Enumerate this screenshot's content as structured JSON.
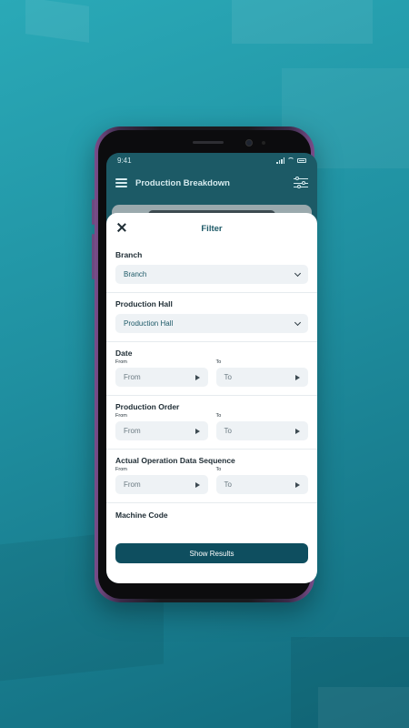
{
  "status_bar": {
    "time": "9:41"
  },
  "app_bar": {
    "title": "Production Breakdown"
  },
  "filter_sheet": {
    "title": "Filter",
    "branch": {
      "label": "Branch",
      "value": "Branch"
    },
    "production_hall": {
      "label": "Production Hall",
      "value": "Production Hall"
    },
    "date": {
      "label": "Date",
      "from_caption": "From",
      "to_caption": "To",
      "from_value": "From",
      "to_value": "To"
    },
    "production_order": {
      "label": "Production Order",
      "from_caption": "From",
      "to_caption": "To",
      "from_value": "From",
      "to_value": "To"
    },
    "operation_sequence": {
      "label": "Actual Operation Data Sequence",
      "from_caption": "From",
      "to_caption": "To",
      "from_value": "From",
      "to_value": "To"
    },
    "machine_code": {
      "label": "Machine Code"
    },
    "show_results_label": "Show Results"
  },
  "colors": {
    "primary": "#0e4e5f",
    "accent_text": "#1e5a68",
    "background": "#1f8fa0"
  }
}
